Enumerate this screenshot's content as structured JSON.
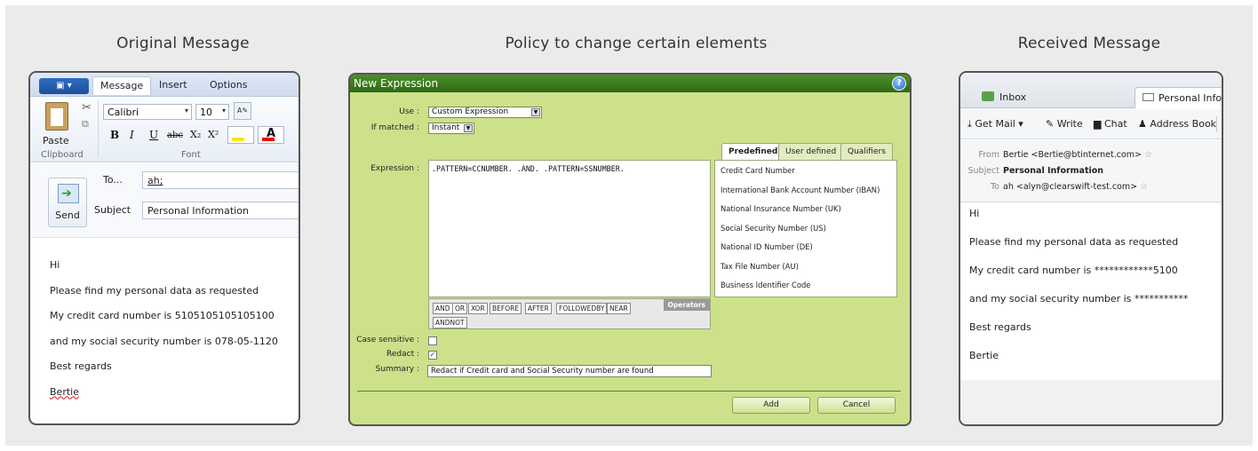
{
  "columns": {
    "original": "Original Message",
    "policy": "Policy to change certain elements",
    "received": "Received Message"
  },
  "outlook": {
    "tabs": [
      "Message",
      "Insert",
      "Options"
    ],
    "clipboard": {
      "paste_label": "Paste",
      "group_label": "Clipboard"
    },
    "font": {
      "family": "Calibri",
      "size": "10",
      "group_label": "Font"
    },
    "format_buttons": [
      "B",
      "I",
      "U",
      "abc",
      "X₂",
      "X²"
    ],
    "send_label": "Send",
    "to_label": "To...",
    "to_value": "ah;",
    "subject_label": "Subject",
    "subject_value": "Personal Information",
    "body": [
      "Hi",
      "Please find my personal data as requested",
      "My credit card number is 5105105105105100",
      "and my social security number is 078-05-1120",
      "Best regards",
      "Bertie"
    ]
  },
  "dialog": {
    "title": "New Expression",
    "use_label": "Use :",
    "use_value": "Custom Expression",
    "if_matched_label": "If matched :",
    "if_matched_value": "Instant",
    "expression_label": "Expression :",
    "expression_value": ".PATTERN=CCNUMBER. .AND. .PATTERN=SSNUMBER.",
    "operators_label": "Operators",
    "operators": [
      "AND",
      "OR",
      "XOR",
      "BEFORE",
      "AFTER",
      "FOLLOWEDBY",
      "NEAR",
      "ANDNOT"
    ],
    "tabs": [
      "Predefined",
      "User defined",
      "Qualifiers"
    ],
    "predefined": [
      "Credit Card Number",
      "International Bank Account Number (IBAN)",
      "National Insurance Number (UK)",
      "Social Security Number (US)",
      "National ID Number (DE)",
      "Tax File Number (AU)",
      "Business Identifier Code"
    ],
    "case_sensitive_label": "Case sensitive :",
    "case_sensitive_checked": false,
    "redact_label": "Redact :",
    "redact_checked": true,
    "summary_label": "Summary :",
    "summary_value": "Redact if Credit card and Social Security number are found",
    "add_label": "Add",
    "cancel_label": "Cancel"
  },
  "thunderbird": {
    "tabs": [
      "Inbox",
      "Personal Inform"
    ],
    "toolbar": [
      "Get Mail",
      "Write",
      "Chat",
      "Address Book"
    ],
    "from_label": "From",
    "from_value": "Bertie <Bertie@btinternet.com>",
    "subject_label": "Subject",
    "subject_value": "Personal Information",
    "to_label": "To",
    "to_value": "ah <alyn@clearswift-test.com>",
    "body": [
      "Hi",
      "Please find my personal data as requested",
      "My credit card number is ************5100",
      "and my social security number is ***********",
      "Best regards",
      "Bertie"
    ]
  }
}
